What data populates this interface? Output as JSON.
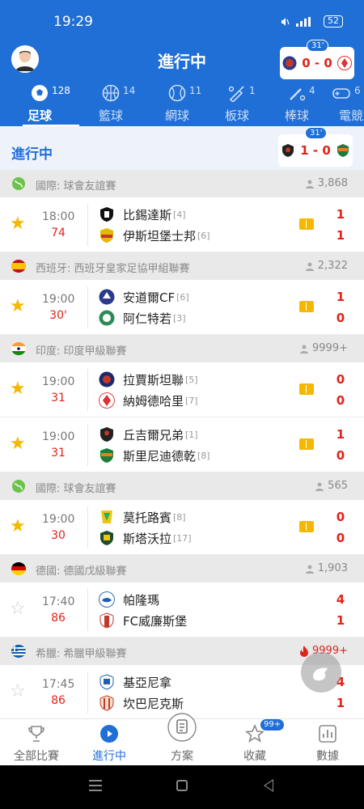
{
  "status_bar": {
    "time": "19:29",
    "battery": "52"
  },
  "header": {
    "title": "進行中",
    "live_card": {
      "minute": "31'",
      "score": "0 - 0"
    }
  },
  "sport_tabs": [
    {
      "label": "足球",
      "count": "128",
      "icon": "soccer-ball-icon",
      "active": true
    },
    {
      "label": "籃球",
      "count": "14",
      "icon": "basketball-icon",
      "active": false
    },
    {
      "label": "網球",
      "count": "11",
      "icon": "tennis-ball-icon",
      "active": false
    },
    {
      "label": "板球",
      "count": "1",
      "icon": "cricket-bat-icon",
      "active": false
    },
    {
      "label": "棒球",
      "count": "4",
      "icon": "baseball-icon",
      "active": false
    },
    {
      "label": "電競",
      "count": "6",
      "icon": "gamepad-icon",
      "active": false
    }
  ],
  "in_play_section": {
    "title": "進行中",
    "live_card": {
      "minute": "31'",
      "score": "1 - 0"
    }
  },
  "leagues": [
    {
      "name": "國際: 球會友誼賽",
      "flag": "globe",
      "watchers": "3,868",
      "hot": false,
      "matches": [
        {
          "starred": true,
          "kickoff": "18:00",
          "minute": "74",
          "home": {
            "name": "比錫達斯",
            "rank": "[4]"
          },
          "away": {
            "name": "伊斯坦堡士邦",
            "rank": "[6]"
          },
          "score_home": "1",
          "score_away": "1"
        }
      ]
    },
    {
      "name": "西班牙: 西班牙皇家足協甲組聯賽",
      "flag": "spain",
      "watchers": "2,322",
      "hot": false,
      "matches": [
        {
          "starred": true,
          "kickoff": "19:00",
          "minute": "30'",
          "home": {
            "name": "安道爾CF",
            "rank": "[6]"
          },
          "away": {
            "name": "阿仁特若",
            "rank": "[3]"
          },
          "score_home": "1",
          "score_away": "0"
        }
      ]
    },
    {
      "name": "印度: 印度甲級聯賽",
      "flag": "india",
      "watchers": "9999+",
      "hot": false,
      "matches": [
        {
          "starred": true,
          "kickoff": "19:00",
          "minute": "31",
          "home": {
            "name": "拉賈斯坦聯",
            "rank": "[5]"
          },
          "away": {
            "name": "納姆德哈里",
            "rank": "[7]"
          },
          "score_home": "0",
          "score_away": "0"
        },
        {
          "starred": true,
          "kickoff": "19:00",
          "minute": "31",
          "home": {
            "name": "丘吉爾兄弟",
            "rank": "[1]"
          },
          "away": {
            "name": "斯里尼迪德乾",
            "rank": "[8]"
          },
          "score_home": "1",
          "score_away": "0"
        }
      ]
    },
    {
      "name": "國際: 球會友誼賽",
      "flag": "globe",
      "watchers": "565",
      "hot": false,
      "matches": [
        {
          "starred": true,
          "kickoff": "19:00",
          "minute": "30",
          "home": {
            "name": "莫托路賓",
            "rank": "[8]"
          },
          "away": {
            "name": "斯塔沃拉",
            "rank": "[17]"
          },
          "score_home": "0",
          "score_away": "0"
        }
      ]
    },
    {
      "name": "德國: 德國戊級聯賽",
      "flag": "germany",
      "watchers": "1,903",
      "hot": false,
      "matches": [
        {
          "starred": false,
          "kickoff": "17:40",
          "minute": "86",
          "home": {
            "name": "帕隆瑪",
            "rank": ""
          },
          "away": {
            "name": "FC威廉斯堡",
            "rank": ""
          },
          "score_home": "4",
          "score_away": "1"
        }
      ]
    },
    {
      "name": "希臘: 希臘甲級聯賽",
      "flag": "greece",
      "watchers": "9999+",
      "hot": true,
      "matches": [
        {
          "starred": false,
          "kickoff": "17:45",
          "minute": "86",
          "home": {
            "name": "基亞尼拿",
            "rank": ""
          },
          "away": {
            "name": "坎巴尼克斯",
            "rank": ""
          },
          "score_home": "4",
          "score_away": "1"
        }
      ]
    }
  ],
  "bottom_nav": [
    {
      "label": "全部比賽",
      "icon": "trophy-icon",
      "active": false
    },
    {
      "label": "進行中",
      "icon": "play-circle-icon",
      "active": true
    },
    {
      "label": "方案",
      "icon": "document-icon",
      "active": false
    },
    {
      "label": "收藏",
      "icon": "star-icon",
      "active": false,
      "badge": "99+"
    },
    {
      "label": "數據",
      "icon": "bar-chart-icon",
      "active": false
    }
  ],
  "colors": {
    "brand_blue": "#1f6fd6",
    "score_red": "#e2231a",
    "star_gold": "#f5b800"
  }
}
